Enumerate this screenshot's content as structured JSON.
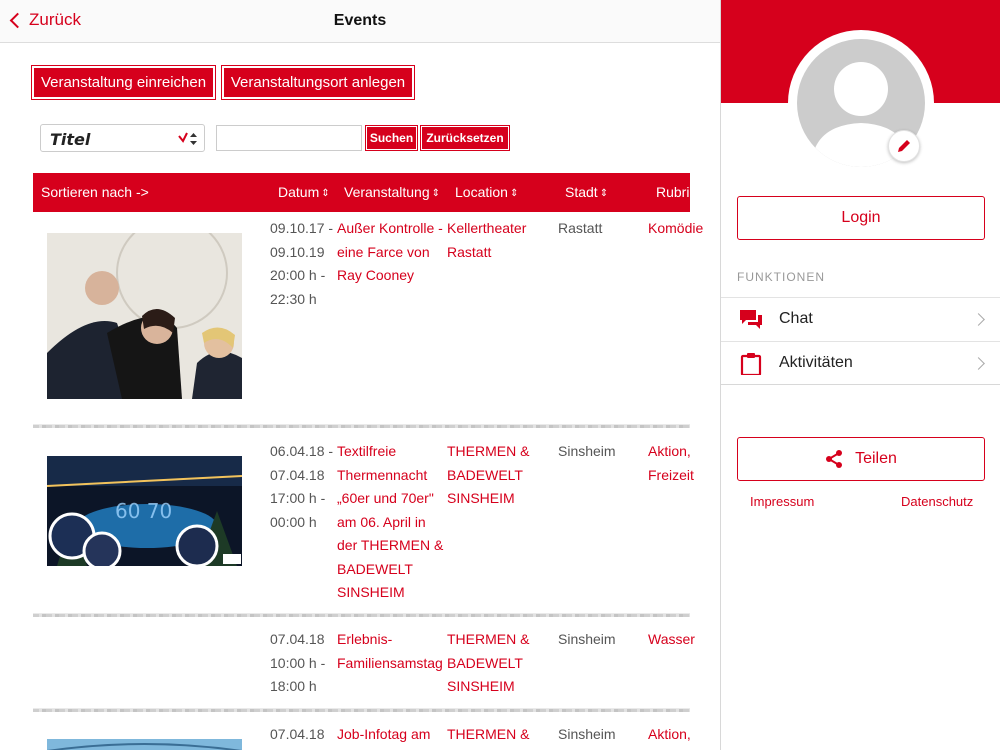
{
  "topbar": {
    "back_label": "Zurück",
    "title": "Events"
  },
  "actions": {
    "submit_event": "Veranstaltung einreichen",
    "create_venue": "Veranstaltungsort anlegen"
  },
  "filter": {
    "selected": "Titel",
    "search_value": "",
    "search_label": "Suchen",
    "reset_label": "Zurücksetzen"
  },
  "table": {
    "sort_label": "Sortieren nach ->",
    "columns": {
      "date": "Datum",
      "event": "Veranstaltung",
      "location": "Location",
      "city": "Stadt",
      "category": "Rubrik"
    },
    "rows": [
      {
        "date": [
          "09.10.17 -",
          "09.10.19",
          "20:00 h -",
          "22:30 h"
        ],
        "event": [
          "Außer Kontrolle -",
          "eine Farce von",
          "Ray Cooney"
        ],
        "location": [
          "Kellertheater",
          "Rastatt"
        ],
        "city": "Rastatt",
        "category": [
          "Komödie"
        ]
      },
      {
        "date": [
          "06.04.18 -",
          "07.04.18",
          "17:00 h -",
          "00:00 h"
        ],
        "event": [
          "Textilfreie",
          "Thermennacht",
          "„60er und 70er\"",
          "am 06. April in",
          "der THERMEN &",
          "BADEWELT",
          "SINSHEIM"
        ],
        "location": [
          "THERMEN &",
          "BADEWELT",
          "SINSHEIM"
        ],
        "city": "Sinsheim",
        "category": [
          "Aktion,",
          "Freizeit"
        ]
      },
      {
        "date": [
          "07.04.18",
          "10:00 h -",
          "18:00 h"
        ],
        "event": [
          "Erlebnis-",
          "Familiensamstag"
        ],
        "location": [
          "THERMEN &",
          "BADEWELT",
          "SINSHEIM"
        ],
        "city": "Sinsheim",
        "category": [
          "Wasser"
        ]
      },
      {
        "date": [
          "07.04.18"
        ],
        "event": [
          "Job-Infotag am"
        ],
        "location": [
          "THERMEN &"
        ],
        "city": "Sinsheim",
        "category": [
          "Aktion,"
        ]
      }
    ]
  },
  "drawer": {
    "login_label": "Login",
    "section_label": "FUNKTIONEN",
    "menu": [
      {
        "label": "Chat",
        "icon": "chat-icon"
      },
      {
        "label": "Aktivitäten",
        "icon": "clipboard-icon"
      }
    ],
    "share_label": "Teilen",
    "impressum": "Impressum",
    "datenschutz": "Datenschutz"
  },
  "colors": {
    "accent": "#d6001c"
  }
}
